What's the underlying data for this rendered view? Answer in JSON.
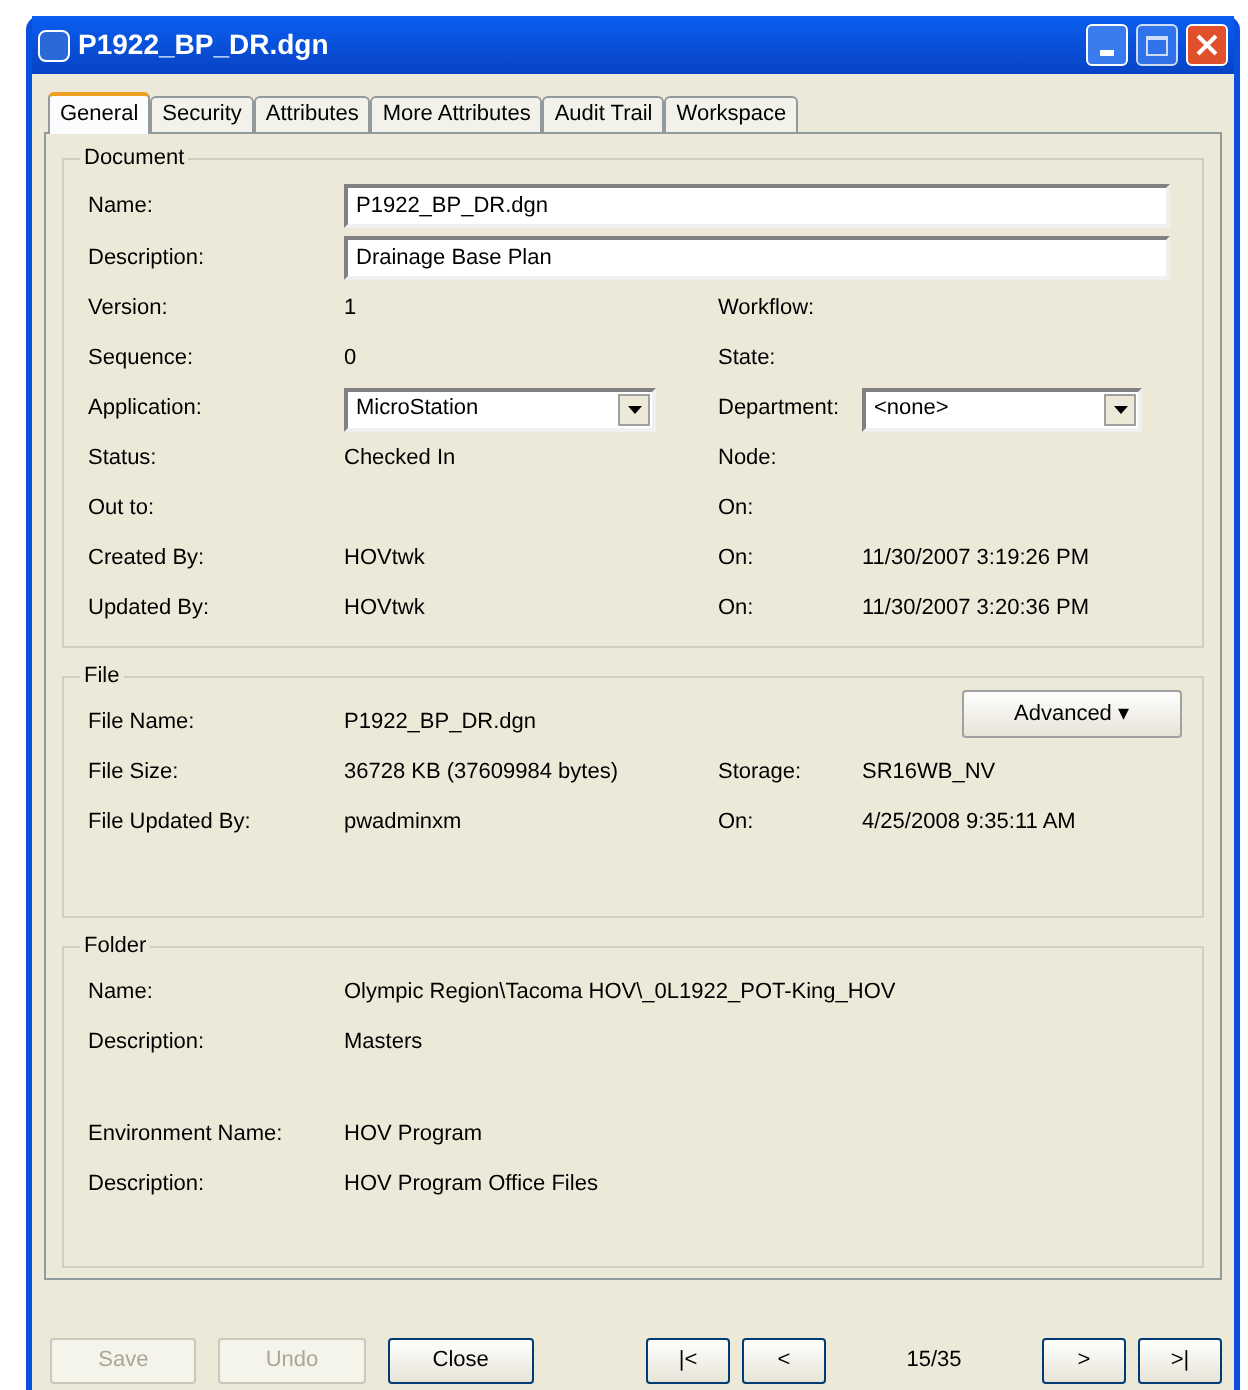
{
  "window": {
    "title": "P1922_BP_DR.dgn"
  },
  "tabs": [
    {
      "label": "General",
      "selected": true
    },
    {
      "label": "Security",
      "selected": false
    },
    {
      "label": "Attributes",
      "selected": false
    },
    {
      "label": "More Attributes",
      "selected": false
    },
    {
      "label": "Audit Trail",
      "selected": false
    },
    {
      "label": "Workspace",
      "selected": false
    }
  ],
  "document": {
    "title": "Document",
    "rows": [
      {
        "kind": "input",
        "label": "Name:",
        "value": "P1922_BP_DR.dgn"
      },
      {
        "kind": "input",
        "label": "Description:",
        "value": "Drainage Base Plan"
      },
      {
        "kind": "pair",
        "left": {
          "label": "Version:",
          "value": "1"
        },
        "right": {
          "label": "Workflow:"
        }
      },
      {
        "kind": "pair",
        "left": {
          "label": "Sequence:",
          "value": "0"
        },
        "right": {
          "label": "State:"
        }
      },
      {
        "kind": "pair",
        "left": {
          "label": "Application:",
          "value": "MicroStation",
          "kind": "select"
        },
        "right": {
          "label": "Department:",
          "value": "<none>",
          "kind": "select"
        }
      },
      {
        "kind": "pair",
        "left": {
          "label": "Status:",
          "value": "Checked In"
        },
        "right": {
          "label": "Node:"
        }
      },
      {
        "kind": "pair",
        "left": {
          "label": "Out to:"
        },
        "right": {
          "label": "On:"
        }
      },
      {
        "kind": "pair",
        "left": {
          "label": "Created By:",
          "value": "HOVtwk"
        },
        "right": {
          "label": "On:",
          "value": "11/30/2007 3:19:26 PM"
        }
      },
      {
        "kind": "pair",
        "left": {
          "label": "Updated By:",
          "value": "HOVtwk"
        },
        "right": {
          "label": "On:",
          "value": "11/30/2007 3:20:36 PM"
        }
      }
    ]
  },
  "file": {
    "title": "File",
    "advanced_button": "Advanced ▾",
    "rows": [
      {
        "kind": "pair",
        "left": {
          "label": "File Name:",
          "value": "P1922_BP_DR.dgn"
        }
      },
      {
        "kind": "pair",
        "left": {
          "label": "File Size:",
          "value": "36728 KB (37609984 bytes)"
        },
        "right": {
          "label": "Storage:",
          "value": "SR16WB_NV"
        }
      },
      {
        "kind": "pair",
        "left": {
          "label": "File Updated By:",
          "value": "pwadminxm"
        },
        "right": {
          "label": "On:",
          "value": "4/25/2008 9:35:11 AM"
        }
      }
    ]
  },
  "folder": {
    "title": "Folder",
    "rows": [
      {
        "kind": "pair",
        "left": {
          "label": "Name:",
          "value": "Olympic Region\\Tacoma HOV\\_0L1922_POT-King_HOV"
        }
      },
      {
        "kind": "pair",
        "left": {
          "label": "Description:",
          "value": "Masters"
        }
      },
      {
        "kind": "spacer"
      },
      {
        "kind": "pair",
        "left": {
          "label": "Environment Name:",
          "value": "HOV Program"
        }
      },
      {
        "kind": "pair",
        "left": {
          "label": "Description:",
          "value": "HOV Program Office Files"
        }
      }
    ]
  },
  "buttons": [
    {
      "label": "Save",
      "disabled": true
    },
    {
      "label": "Undo",
      "disabled": true
    },
    {
      "label": "Close",
      "disabled": false
    }
  ],
  "navigation": {
    "first": "|<",
    "previous": "<",
    "position": "15/35",
    "next": ">",
    "last": ">|"
  }
}
